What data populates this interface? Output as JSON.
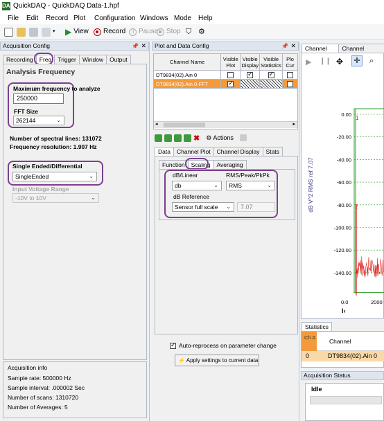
{
  "window": {
    "app_icon": "DAQ",
    "title": "QuickDAQ - QuickDAQ Data-1.hpf"
  },
  "menu": [
    "File",
    "Edit",
    "Record",
    "Plot",
    "Configuration",
    "Windows",
    "Mode",
    "Help"
  ],
  "toolbar": {
    "view": "View",
    "record": "Record",
    "pause": "Pause",
    "stop": "Stop"
  },
  "acq": {
    "header": "Acquisition Config",
    "tabs": [
      "Recording",
      "Freq",
      "Trigger",
      "Window",
      "Output"
    ],
    "section_title": "Analysis Frequency",
    "max_freq_label": "Maximum frequency to analyze",
    "max_freq_value": "250000",
    "fft_label": "FFT Size",
    "fft_value": "262144",
    "spectral_lines": "Number of spectral lines: 131072",
    "freq_res": "Frequency resolution: 1.907 Hz",
    "se_label": "Single Ended/Differential",
    "se_value": "SingleEnded",
    "ivr_label": "Input Voltage Range",
    "ivr_value": "-10V to 10V",
    "info_header": "Acquisition info",
    "info": [
      "Sample rate: 500000 Hz",
      "Sample interval: .000002 Sec",
      "Number of scans: 1310720",
      "Number of Averages: 5"
    ]
  },
  "pdc": {
    "header": "Plot and Data Config",
    "cols": [
      "Channel Name",
      "Visible Plot",
      "Visible Display",
      "Visible Statistics",
      "Plo Cur"
    ],
    "rows": [
      {
        "name": "DT9834(02).Ain 0"
      },
      {
        "name": "DT9834(02).Ain 0-FFT"
      }
    ],
    "actions": "Actions",
    "tabs": [
      "Data",
      "Channel Plot",
      "Channel Display",
      "Stats"
    ],
    "subtabs": [
      "Function",
      "Scaling",
      "Averaging"
    ],
    "dblinear_label": "dB/Linear",
    "dblinear_value": "db",
    "rms_label": "RMS/Peak/PkPk",
    "rms_value": "RMS",
    "dbref_label": "dB Reference",
    "dbref_value": "Sensor full scale",
    "dbref_num": "7.07",
    "auto_reprocess": "Auto-reprocess on parameter change",
    "apply_btn": "Apply settings to current data"
  },
  "plot": {
    "tabs": [
      "Channel Plot",
      "Channel Display"
    ],
    "ylabel": "dB V^2  RMS ref 7.07",
    "yticks": [
      "0.00",
      "-20.00",
      "-40.00",
      "-60.00",
      "-80.00",
      "-100.00",
      "-120.00",
      "-140.00"
    ],
    "xticks": [
      "0.0",
      "2000"
    ],
    "marker1": "1",
    "marker2": "2"
  },
  "stats": {
    "tab": "Statistics",
    "col_ch": "Ch #",
    "col_channel": "Channel",
    "row_ch": "0",
    "row_channel": "DT9834(02).Ain 0"
  },
  "acqstatus": {
    "header": "Acquisition Status",
    "status": "Idle"
  },
  "colors": {
    "accent": "#7b3f8f",
    "selected_row": "#f39a3c",
    "trace": "#e02020",
    "grid": "#2a9d2a"
  }
}
